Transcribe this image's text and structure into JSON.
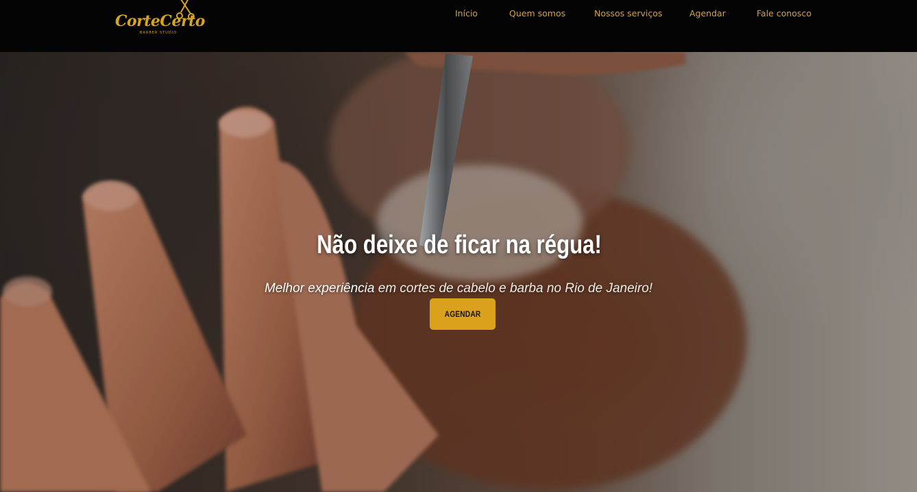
{
  "brand": {
    "logo_text": "CorteCerto",
    "logo_subtext": "BARBER STUDIO"
  },
  "nav": {
    "items": [
      {
        "label": "Início"
      },
      {
        "label": "Quem somos"
      },
      {
        "label": "Nossos serviços"
      },
      {
        "label": "Agendar"
      },
      {
        "label": "Fale conosco"
      }
    ]
  },
  "hero": {
    "headline": "Não deixe de ficar na régua!",
    "subline_emphasis": "Melhor experiência",
    "subline_rest": " em cortes de cabelo e barba no Rio de Janeiro!",
    "cta_label": "AGENDAR",
    "image_subject": "barber-shaving-beard-with-straight-razor"
  },
  "colors": {
    "accent": "#dba11c",
    "nav_text": "#d6a23e",
    "topbar_bg": "#040404"
  }
}
